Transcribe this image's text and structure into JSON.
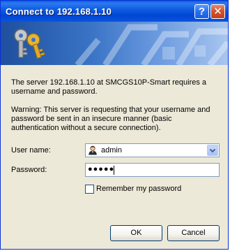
{
  "window": {
    "title": "Connect to 192.168.1.10"
  },
  "titlebar": {
    "help_glyph": "?",
    "close_glyph": "✕"
  },
  "banner": {
    "icon": "keys-icon"
  },
  "message": {
    "text": "The server 192.168.1.10 at SMCGS10P-Smart requires a username and password.",
    "warning": "Warning: This server is requesting that your username and password be sent in an insecure manner (basic authentication without a secure connection)."
  },
  "form": {
    "username_label": "User name:",
    "username_value": "admin",
    "password_label": "Password:",
    "password_value": "●●●●●",
    "remember_label": "Remember my password",
    "remember_checked": false
  },
  "buttons": {
    "ok": "OK",
    "cancel": "Cancel"
  },
  "colors": {
    "titlebar": "#0a5fd8",
    "dialog_bg": "#ece9d8",
    "input_border": "#7f9db9"
  }
}
